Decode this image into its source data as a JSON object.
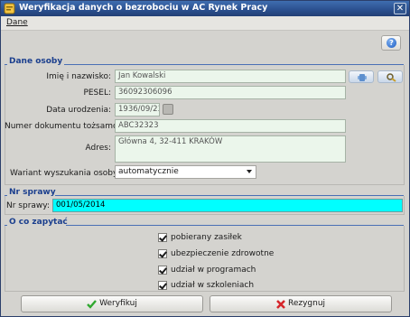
{
  "window": {
    "title": "Weryfikacja danych o bezrobociu w AC Rynek Pracy"
  },
  "menu": {
    "dane": "Dane"
  },
  "sections": {
    "dane_osoby": "Dane osoby",
    "nr_sprawy": "Nr sprawy",
    "o_co_zapytac": "O co zapytać"
  },
  "form": {
    "name_label": "Imię i nazwisko:",
    "name_value": "Jan Kowalski",
    "pesel_label": "PESEL:",
    "pesel_value": "36092306096",
    "birth_label": "Data urodzenia:",
    "birth_value": "1936/09/23",
    "doc_label": "Numer dokumentu tożsamości:",
    "doc_value": "ABC32323",
    "address_label": "Adres:",
    "address_value": "Główna 4, 32-411 KRAKÓW",
    "variant_label": "Wariant wyszukania osoby:",
    "variant_value": "automatycznie",
    "case_label": "Nr sprawy:",
    "case_value": "001/05/2014"
  },
  "checks": [
    {
      "label": "pobierany zasiłek",
      "checked": true
    },
    {
      "label": "ubezpieczenie zdrowotne",
      "checked": true
    },
    {
      "label": "udział w programach",
      "checked": true
    },
    {
      "label": "udział w szkoleniach",
      "checked": true
    }
  ],
  "buttons": {
    "verify": "Weryfikuj",
    "cancel": "Rezygnuj"
  },
  "icons": {
    "app": "window-app-icon",
    "close": "close-icon",
    "help": "help-icon",
    "person_pick": "person-pick-icon",
    "search": "search-icon",
    "calendar": "calendar-icon",
    "verify": "checkmark-icon",
    "cancel": "cancel-x-icon"
  },
  "colors": {
    "titlebar": "#2a4f8e",
    "section_title": "#1b3f8e",
    "field_bg": "#ebf6eb",
    "case_field_bg": "#00ffff",
    "verify_icon": "#2fa82f",
    "cancel_icon": "#d6262b"
  }
}
